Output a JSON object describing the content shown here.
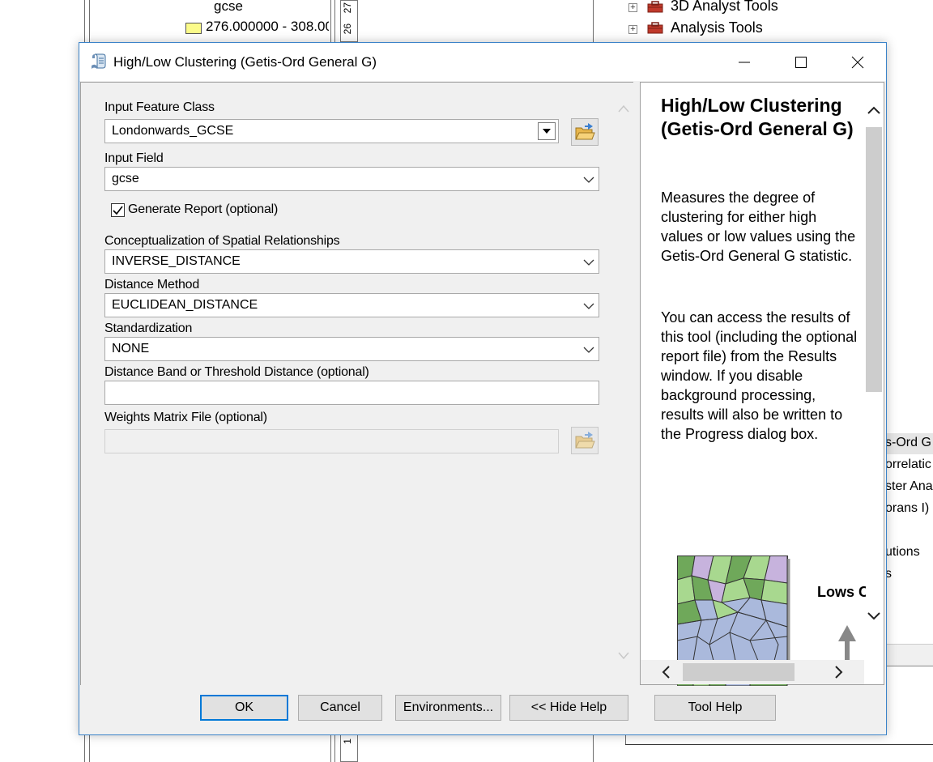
{
  "background": {
    "legend_field": "gcse",
    "legend_range": "276.000000 - 308.00",
    "ruler_labels": [
      "27",
      "26",
      "1"
    ],
    "toolbox_items": [
      {
        "label": "3D Analyst Tools",
        "expander": "+"
      },
      {
        "label": "Analysis Tools",
        "expander": "+"
      }
    ],
    "right_peek_items": [
      "s-Ord G",
      "orrelatic",
      "ster Ana",
      "orans I)",
      "utions",
      "s"
    ]
  },
  "dialog": {
    "title": "High/Low Clustering (Getis-Ord General G)",
    "title_icon": "script-tool-icon",
    "window_buttons": [
      "minimize-icon",
      "maximize-icon",
      "close-icon"
    ],
    "params": {
      "input_feature_class": {
        "label": "Input Feature Class",
        "value": "Londonwards_GCSE"
      },
      "input_field": {
        "label": "Input Field",
        "value": "gcse"
      },
      "generate_report": {
        "label": "Generate Report (optional)",
        "checked": true
      },
      "conceptualization": {
        "label": "Conceptualization of Spatial Relationships",
        "value": "INVERSE_DISTANCE"
      },
      "distance_method": {
        "label": "Distance Method",
        "value": "EUCLIDEAN_DISTANCE"
      },
      "standardization": {
        "label": "Standardization",
        "value": "NONE"
      },
      "distance_band": {
        "label": "Distance Band or Threshold Distance (optional)",
        "value": ""
      },
      "weights_matrix": {
        "label": "Weights Matrix File (optional)",
        "value": ""
      }
    },
    "help": {
      "title": "High/Low Clustering (Getis-Ord General G)",
      "paragraphs": [
        "Measures the degree of clustering for either high values or low values using the Getis-Ord General G statistic.",
        "You can access the results of this tool (including the optional report file) from the Results window. If you disable background processing, results will also be written to the Progress dialog box."
      ],
      "illustration_label": "Lows Clust"
    },
    "buttons": {
      "ok": "OK",
      "cancel": "Cancel",
      "environments": "Environments...",
      "hide_help": "<< Hide Help",
      "tool_help": "Tool Help"
    },
    "colors": {
      "accent_border": "#0078d7",
      "map_green": "#6fa85a",
      "map_light_green": "#a8d88f",
      "map_purple": "#c7b3dd",
      "map_blue": "#aab9dc"
    }
  }
}
